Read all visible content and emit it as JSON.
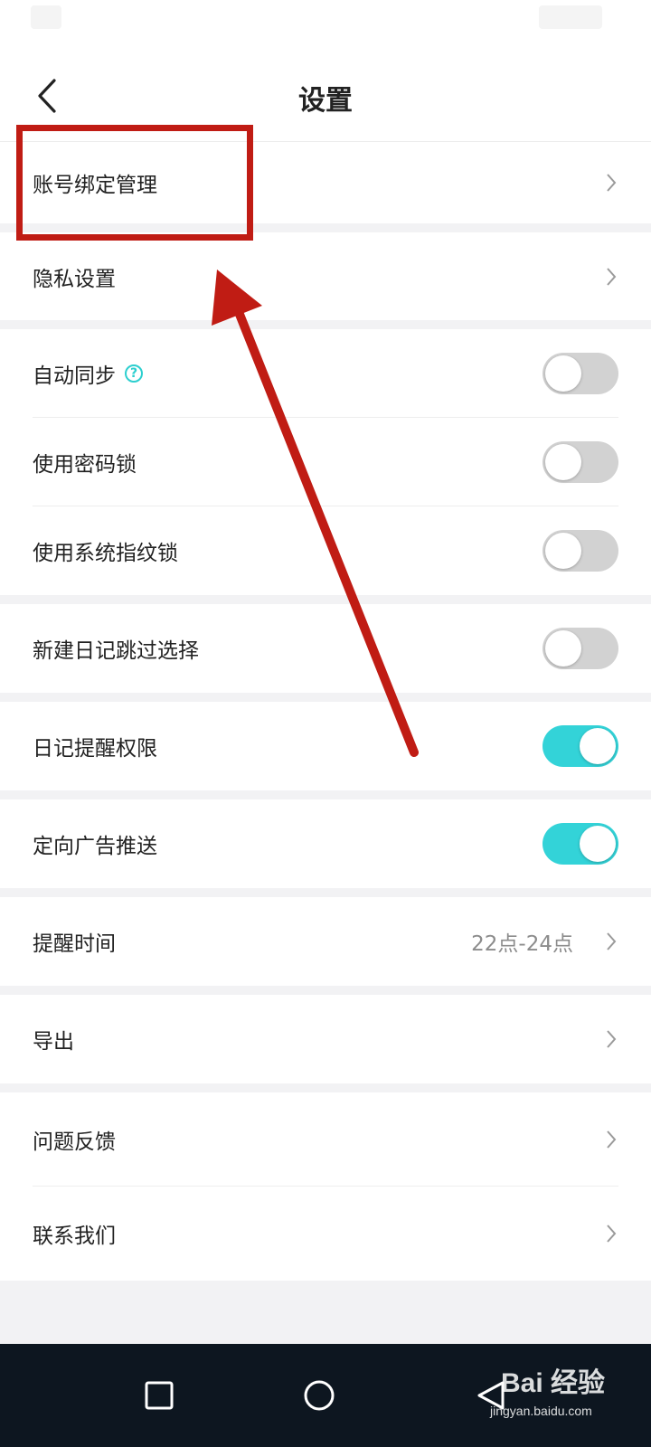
{
  "header": {
    "title": "设置"
  },
  "rows": {
    "account_binding": {
      "label": "账号绑定管理"
    },
    "privacy": {
      "label": "隐私设置"
    },
    "auto_sync": {
      "label": "自动同步",
      "enabled": false
    },
    "password_lock": {
      "label": "使用密码锁",
      "enabled": false
    },
    "fingerprint_lock": {
      "label": "使用系统指纹锁",
      "enabled": false
    },
    "skip_select": {
      "label": "新建日记跳过选择",
      "enabled": false
    },
    "reminder_permission": {
      "label": "日记提醒权限",
      "enabled": true
    },
    "targeted_ads": {
      "label": "定向广告推送",
      "enabled": true
    },
    "reminder_time": {
      "label": "提醒时间",
      "value": "22点-24点"
    },
    "export": {
      "label": "导出"
    },
    "feedback": {
      "label": "问题反馈"
    },
    "contact": {
      "label": "联系我们"
    }
  },
  "icons": {
    "back": "chevron-left-icon",
    "chevron": "chevron-right-icon",
    "help": "help-circle-icon",
    "nav_recent": "square-icon",
    "nav_home": "circle-icon",
    "nav_back": "triangle-back-icon"
  },
  "colors": {
    "toggle_on": "#33d3d8",
    "toggle_off": "#d2d2d2",
    "annotation": "#c01c14"
  },
  "watermark": {
    "brand": "Bai 经验",
    "url": "jingyan.baidu.com"
  }
}
